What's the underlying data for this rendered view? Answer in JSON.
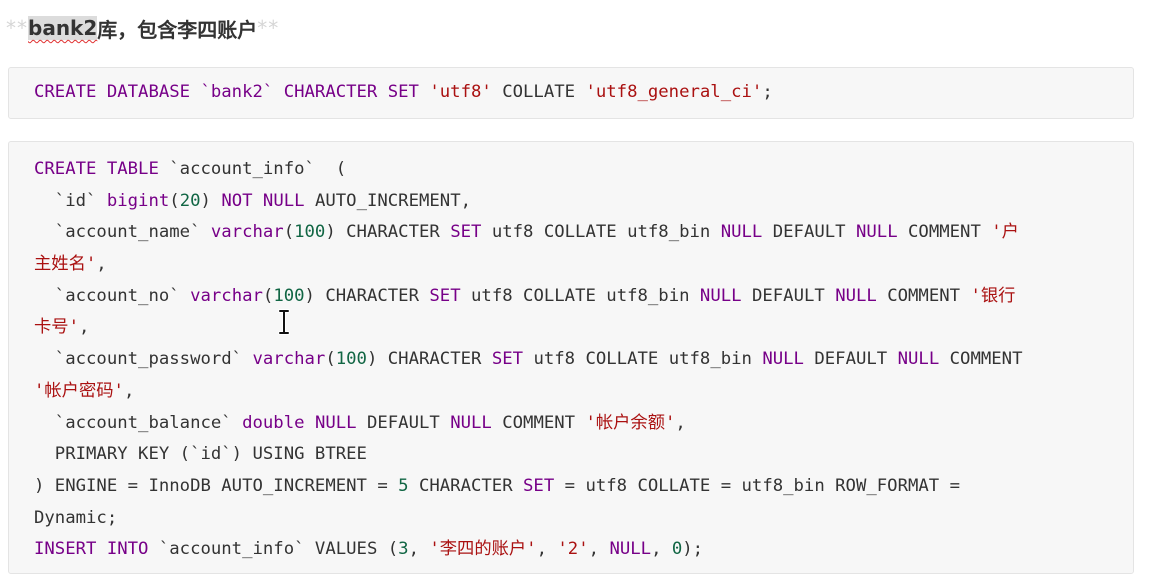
{
  "heading": {
    "prefix_marks": "**",
    "highlighted": "bank2",
    "text": "库，包含李四账户",
    "suffix_marks": "**"
  },
  "code_block_1": {
    "t1": "CREATE DATABASE `bank2` ",
    "t2": "CHARACTER SET",
    "t3": " ",
    "t4": "'utf8'",
    "t5": " COLLATE ",
    "t6": "'utf8_general_ci'",
    "t7": ";"
  },
  "code_block_2": {
    "l1_a": "CREATE TABLE",
    "l1_b": " `account_info`  (",
    "l2_a": "  `id` ",
    "l2_b": "bigint",
    "l2_c": "(",
    "l2_d": "20",
    "l2_e": ") ",
    "l2_f": "NOT NULL",
    "l2_g": " AUTO_INCREMENT,",
    "l3_a": "  `account_name` ",
    "l3_b": "varchar",
    "l3_c": "(",
    "l3_d": "100",
    "l3_e": ") CHARACTER ",
    "l3_f": "SET",
    "l3_g": " utf8 COLLATE utf8_bin ",
    "l3_h": "NULL",
    "l3_i": " DEFAULT ",
    "l3_j": "NULL",
    "l3_k": " COMMENT ",
    "l3_l": "'户",
    "l4_a": "主姓名'",
    "l4_b": ",",
    "l5_a": "  `account_no` ",
    "l5_b": "varchar",
    "l5_c": "(",
    "l5_d": "100",
    "l5_e": ") CHARACTER ",
    "l5_f": "SET",
    "l5_g": " utf8 COLLATE utf8_bin ",
    "l5_h": "NULL",
    "l5_i": " DEFAULT ",
    "l5_j": "NULL",
    "l5_k": " COMMENT ",
    "l5_l": "'银行",
    "l6_a": "卡号'",
    "l6_b": ",",
    "l7_a": "  `account_password` ",
    "l7_b": "varchar",
    "l7_c": "(",
    "l7_d": "100",
    "l7_e": ") CHARACTER ",
    "l7_f": "SET",
    "l7_g": " utf8 COLLATE utf8_bin ",
    "l7_h": "NULL",
    "l7_i": " DEFAULT ",
    "l7_j": "NULL",
    "l7_k": " COMMENT",
    "l8_a": "'帐户密码'",
    "l8_b": ",",
    "l9_a": "  `account_balance` ",
    "l9_b": "double",
    "l9_c": " ",
    "l9_d": "NULL",
    "l9_e": " DEFAULT ",
    "l9_f": "NULL",
    "l9_g": " COMMENT ",
    "l9_h": "'帐户余额'",
    "l9_i": ",",
    "l10": "  PRIMARY KEY (`id`) USING BTREE",
    "l11_a": ") ENGINE = InnoDB AUTO_INCREMENT = ",
    "l11_b": "5",
    "l11_c": " CHARACTER ",
    "l11_d": "SET",
    "l11_e": " = utf8 COLLATE = utf8_bin ROW_FORMAT =",
    "l12": "Dynamic;",
    "l13_a": "INSERT INTO",
    "l13_b": " `account_info` VALUES (",
    "l13_c": "3",
    "l13_d": ", ",
    "l13_e": "'李四的账户'",
    "l13_f": ", ",
    "l13_g": "'2'",
    "l13_h": ", ",
    "l13_i": "NULL",
    "l13_j": ", ",
    "l13_k": "0",
    "l13_l": ");"
  },
  "colors": {
    "keyword": "#770088",
    "string": "#aa1111",
    "number": "#116644",
    "code_background": "#f7f7f7"
  },
  "icons": {
    "cursor": "text-cursor-icon"
  }
}
